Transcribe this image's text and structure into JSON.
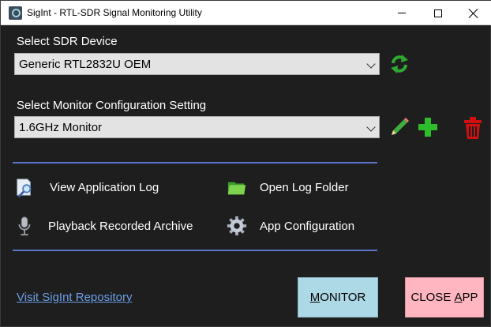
{
  "window": {
    "title": "SigInt - RTL-SDR Signal Monitoring Utility"
  },
  "device": {
    "label": "Select SDR Device",
    "selected": "Generic RTL2832U OEM",
    "refresh_icon": "refresh-icon"
  },
  "config": {
    "label": "Select Monitor Configuration Setting",
    "selected": "1.6GHz Monitor",
    "edit_icon": "pencil-icon",
    "add_icon": "plus-icon",
    "delete_icon": "trash-icon"
  },
  "actions": {
    "view_log": "View Application Log",
    "open_folder": "Open Log Folder",
    "playback": "Playback Recorded Archive",
    "app_config": "App Configuration"
  },
  "footer": {
    "repo_link": "Visit SigInt Repository",
    "monitor_button_prefix": "",
    "monitor_button_underlined": "M",
    "monitor_button_rest": "ONITOR",
    "close_button_prefix": "CLOSE ",
    "close_button_underlined": "A",
    "close_button_rest": "PP"
  },
  "colors": {
    "background": "#1e1e1e",
    "divider": "#5a74c8",
    "monitor_button": "#add8e6",
    "close_button": "#ffb6c1",
    "link": "#6b9fe8",
    "refresh_green": "#2fa832",
    "add_green": "#2ebd2a",
    "delete_red": "#d01010"
  }
}
